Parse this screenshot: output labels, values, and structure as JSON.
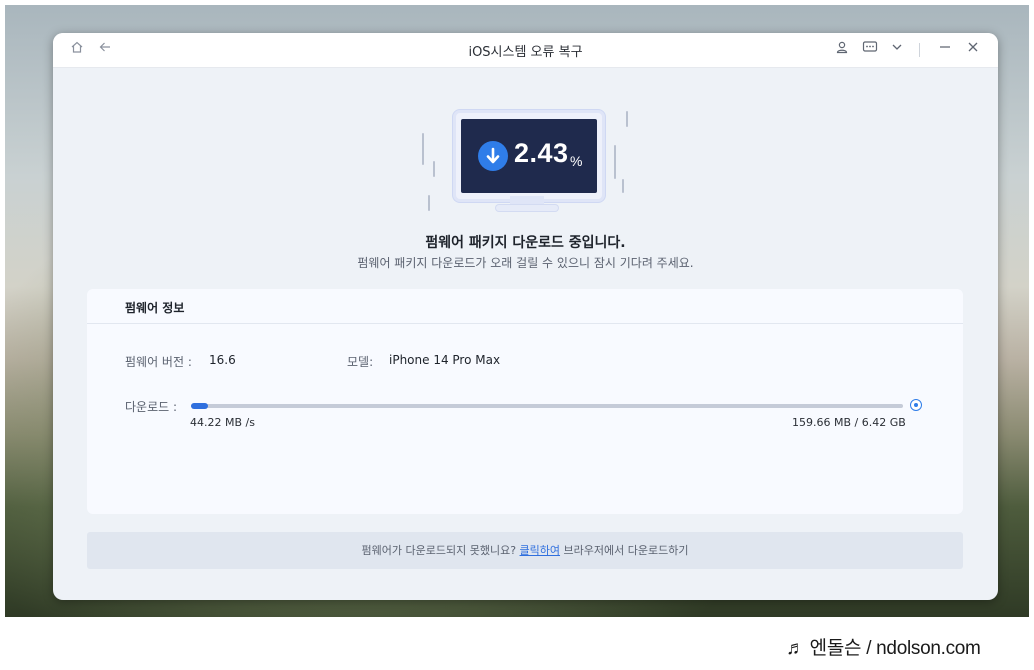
{
  "window": {
    "title": "iOS시스템 오류 복구"
  },
  "titlebar_icons": {
    "home": "home-icon",
    "back": "back-arrow-icon",
    "account": "user-icon",
    "feedback": "chat-icon",
    "menu": "chevron-down-icon",
    "minimize": "minimize-icon",
    "close": "close-icon"
  },
  "download": {
    "percent_value": "2.43",
    "percent_sign": "%",
    "progress_fraction": 0.0243,
    "headline": "펌웨어 패키지 다운로드 중입니다.",
    "subline": "펌웨어 패키지 다운로드가 오래 걸릴 수 있으니 잠시 기다려 주세요."
  },
  "firmware": {
    "section_title": "펌웨어 정보",
    "version_label": "펌웨어 버전 :",
    "version_value": "16.6",
    "model_label": "모델:",
    "model_value": "iPhone 14 Pro Max",
    "download_label": "다운로드 :",
    "speed": "44.22 MB /s",
    "size_progress": "159.66 MB / 6.42 GB"
  },
  "footer": {
    "prefix": "펌웨어가 다운로드되지 못했니요?",
    "link": "클릭하여",
    "suffix": "브라우저에서 다운로드하기"
  },
  "watermark": {
    "text": "♬ 엔돌슨 / ndolson.com"
  },
  "colors": {
    "accent": "#2f7de9",
    "screen": "#1f2a4d",
    "window_bg": "#eef2f7"
  }
}
